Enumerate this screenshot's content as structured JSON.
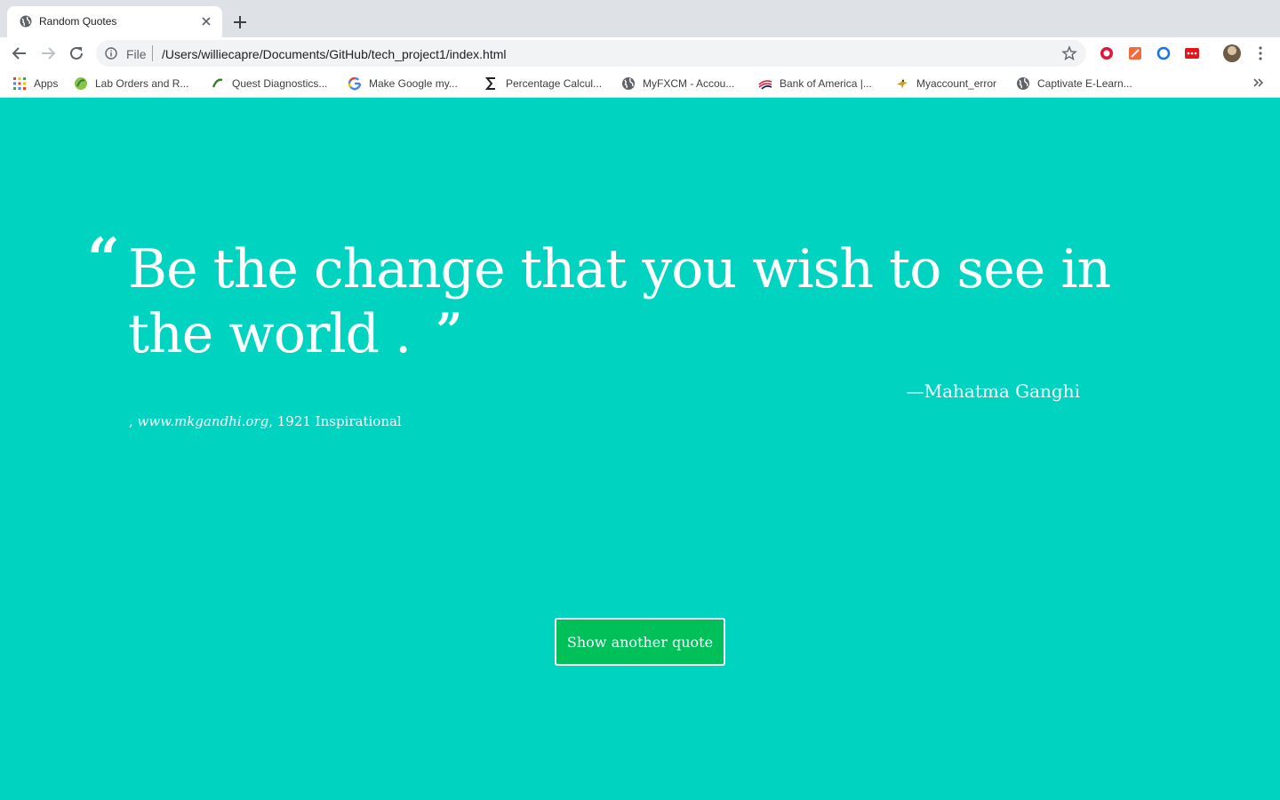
{
  "browser": {
    "tab": {
      "title": "Random Quotes"
    },
    "omnibox": {
      "scheme": "File",
      "url": "/Users/williecapre/Documents/GitHub/tech_project1/index.html"
    },
    "bookmarks": [
      {
        "label": "Apps",
        "icon": "apps-grid-icon"
      },
      {
        "label": "Lab Orders and R...",
        "icon": "quest-leaf-icon"
      },
      {
        "label": "Quest Diagnostics...",
        "icon": "quest-leaf-icon"
      },
      {
        "label": "Make Google my...",
        "icon": "google-icon"
      },
      {
        "label": "Percentage Calcul...",
        "icon": "sigma-icon"
      },
      {
        "label": "MyFXCM - Accou...",
        "icon": "globe-icon"
      },
      {
        "label": "Bank of America |...",
        "icon": "bofa-icon"
      },
      {
        "label": "Myaccount_error",
        "icon": "bird-icon"
      },
      {
        "label": "Captivate E-Learn...",
        "icon": "globe-icon"
      }
    ]
  },
  "quote": {
    "open_mark": "“",
    "text": "Be the change that you wish to see in the world .",
    "close_mark": "”",
    "author": "—Mahatma Ganghi",
    "citation_prefix": ", ",
    "citation_source": "www.mkgandhi.org",
    "citation_suffix": ", 1921 Inspirational"
  },
  "button": {
    "label": "Show another quote"
  },
  "colors": {
    "page_background": "#00d4c0",
    "button_background": "#00c05a",
    "text": "#ffffff"
  }
}
